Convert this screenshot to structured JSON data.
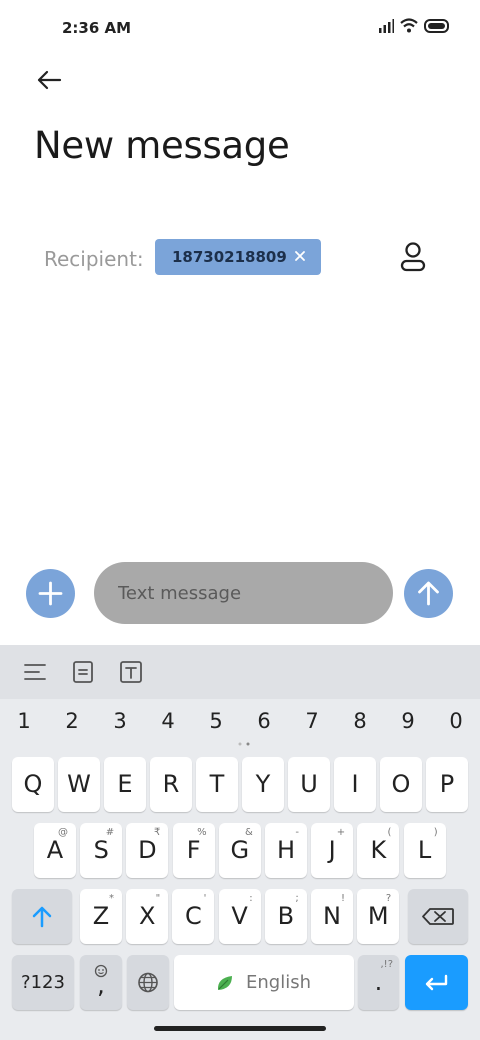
{
  "status_bar": {
    "time": "2:36 AM"
  },
  "header": {
    "title": "New message"
  },
  "recipient": {
    "label": "Recipient:",
    "chip": "18730218809"
  },
  "compose": {
    "placeholder": "Text message"
  },
  "keyboard": {
    "numbers": [
      "1",
      "2",
      "3",
      "4",
      "5",
      "6",
      "7",
      "8",
      "9",
      "0"
    ],
    "row1": [
      "Q",
      "W",
      "E",
      "R",
      "T",
      "Y",
      "U",
      "I",
      "O",
      "P"
    ],
    "row2": [
      {
        "key": "A",
        "sub": "@"
      },
      {
        "key": "S",
        "sub": "#"
      },
      {
        "key": "D",
        "sub": "₹"
      },
      {
        "key": "F",
        "sub": "%"
      },
      {
        "key": "G",
        "sub": "&"
      },
      {
        "key": "H",
        "sub": "-"
      },
      {
        "key": "J",
        "sub": "+"
      },
      {
        "key": "K",
        "sub": "("
      },
      {
        "key": "L",
        "sub": ")"
      }
    ],
    "row3": [
      {
        "key": "Z",
        "sub": "*"
      },
      {
        "key": "X",
        "sub": "\""
      },
      {
        "key": "C",
        "sub": "'"
      },
      {
        "key": "V",
        "sub": ":"
      },
      {
        "key": "B",
        "sub": ";"
      },
      {
        "key": "N",
        "sub": "!"
      },
      {
        "key": "M",
        "sub": "?"
      }
    ],
    "symbols_label": "?123",
    "comma_label": ",",
    "space_label": "English",
    "period_label": ".",
    "period_sub": ",!?"
  },
  "colors": {
    "accent": "#7ba4d9",
    "enter_key": "#1a9cff",
    "input_bg": "#a9a9a9"
  }
}
